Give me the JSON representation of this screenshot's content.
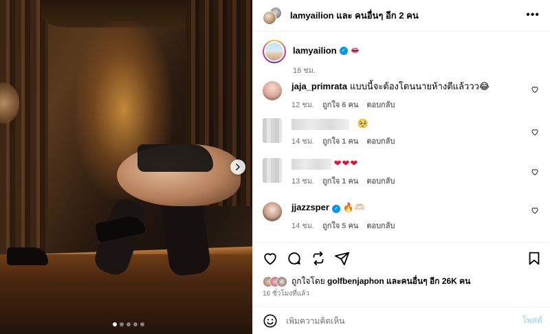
{
  "header": {
    "title": "lamyailion และ คนอื่นๆ อีก 2 คน",
    "more_icon": "more-horizontal-icon"
  },
  "author": {
    "username": "lamyailion",
    "verified": true,
    "emoji": "lips",
    "time": "16 ชม."
  },
  "comments": [
    {
      "username": "jaja_primrata",
      "text": "แบบนี้จะต้องโดนนายห้างตีแล้ววว😂",
      "time": "12 ชม.",
      "likes": "ถูกใจ 6 คน",
      "reply": "ตอบกลับ",
      "blurred": false
    },
    {
      "username": "",
      "text": "🥺",
      "time": "14 ชม.",
      "likes": "ถูกใจ 1 คน",
      "reply": "ตอบกลับ",
      "blurred": true
    },
    {
      "username": "",
      "text": "❤❤❤",
      "time": "13 ชม.",
      "likes": "ถูกใจ 1 คน",
      "reply": "ตอบกลับ",
      "blurred": true
    },
    {
      "username": "jjazzsper",
      "text": "🔥🫶🏻",
      "time": "14 ชม.",
      "likes": "ถูกใจ 5 คน",
      "reply": "ตอบกลับ",
      "blurred": false,
      "verified": true
    }
  ],
  "likes_summary": {
    "prefix": "ถูกใจโดย ",
    "user": "golfbenjaphon",
    "suffix": " และคนอื่นๆ อีก 26K คน"
  },
  "posted_ago": "16 ชั่วโมงที่แล้ว",
  "comment_box": {
    "placeholder": "เพิ่มความคิดเห็น",
    "post_label": "โพสต์"
  },
  "carousel": {
    "total": 5,
    "active_index": 0
  },
  "colors": {
    "verified": "#0095f6",
    "post_disabled": "#b2dffc",
    "muted": "#737373"
  }
}
